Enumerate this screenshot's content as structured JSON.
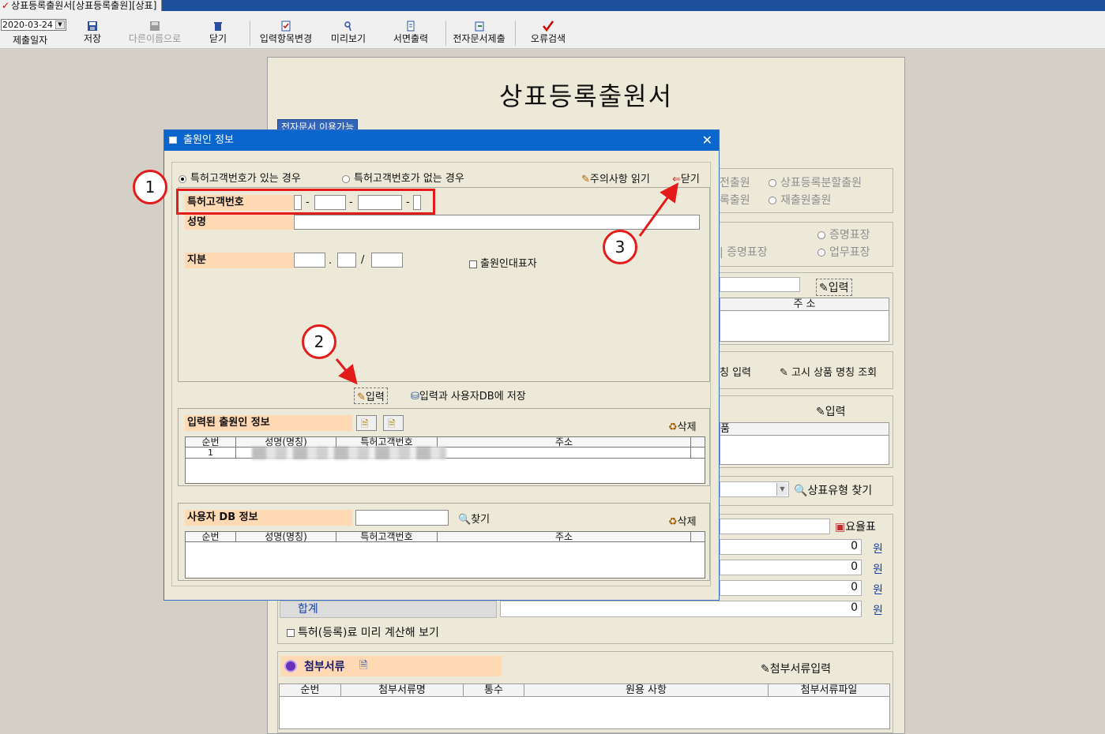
{
  "window": {
    "title": "상표등록출원서[상표등록출원][상표]"
  },
  "toolbar": {
    "date_value": "2020-03-24",
    "date_label": "제출일자",
    "buttons": [
      {
        "label": "저장"
      },
      {
        "label": "다른이름으로"
      },
      {
        "label": "닫기"
      },
      {
        "label": "입력항목변경"
      },
      {
        "label": "미리보기"
      },
      {
        "label": "서면출력"
      },
      {
        "label": "전자문서제출"
      },
      {
        "label": "오류검색"
      }
    ]
  },
  "form": {
    "title": "상표등록출원서",
    "edoc_badge": "전자문서 이용가능",
    "app_types": [
      "전출원",
      "상표등록분할출원",
      "록출원",
      "재출원출원"
    ],
    "mark_types": [
      "증명표장",
      "증명표장",
      "업무표장"
    ],
    "input_label": "입력",
    "address_header": "주 소",
    "product_buttons": [
      "칭 입력",
      "고시 상품 명칭 조회"
    ],
    "product_header": "품",
    "mark_type_search": "상표유형 찾기",
    "fee_table": "요율표",
    "fee_values": [
      "0",
      "0",
      "0"
    ],
    "won": "원",
    "sum_label": "합계",
    "sum_value": "0",
    "precalc_label": "특허(등록)료 미리 계산해 보기",
    "attach": {
      "title": "첨부서류",
      "input_label": "첨부서류입력",
      "columns": [
        "순번",
        "첨부서류명",
        "통수",
        "원용 사항",
        "첨부서류파일"
      ]
    }
  },
  "dialog": {
    "title": "출원인 정보",
    "radio_with": "특허고객번호가 있는 경우",
    "radio_without": "특허고객번호가 없는 경우",
    "notice_label": "주의사항 읽기",
    "close_label": "닫기",
    "customer_no_label": "특허고객번호",
    "name_label": "성명",
    "share_label": "지분",
    "rep_label": "출원인대표자",
    "input_label": "입력",
    "save_label": "입력과 사용자DB에 저장",
    "entered": {
      "title": "입력된 출원인 정보",
      "delete_label": "삭제",
      "columns": [
        "순번",
        "성명(명칭)",
        "특허고객번호",
        "주소"
      ],
      "rows": [
        [
          "1",
          "",
          "",
          ""
        ]
      ]
    },
    "userdb": {
      "title": "사용자 DB 정보",
      "search_label": "찾기",
      "delete_label": "삭제",
      "columns": [
        "순번",
        "성명(명칭)",
        "특허고객번호",
        "주소"
      ]
    }
  },
  "annotations": [
    "1",
    "2",
    "3"
  ],
  "colors": {
    "annotation_red": "#e31b1b",
    "label_bg": "#ffd9b3",
    "dialog_title": "#0a66cc"
  }
}
